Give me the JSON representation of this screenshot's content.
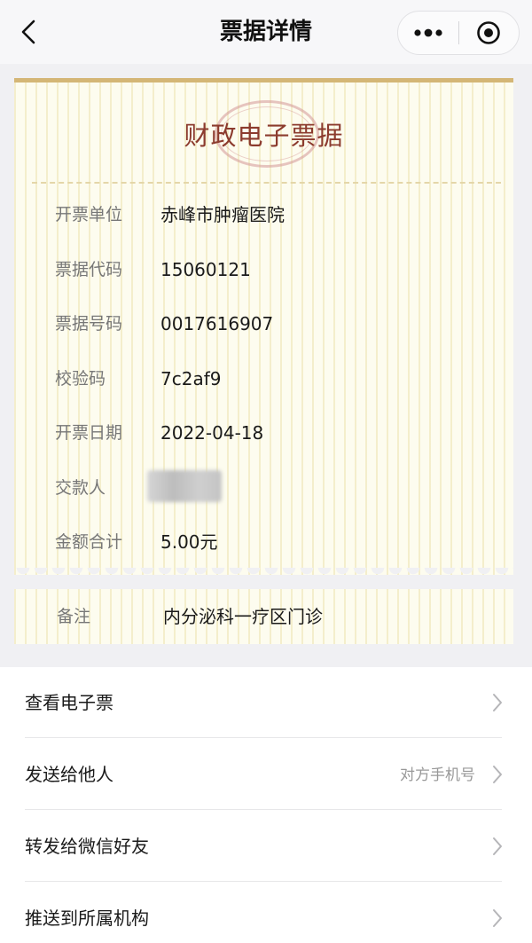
{
  "nav": {
    "title": "票据详情"
  },
  "receipt": {
    "title": "财政电子票据",
    "rows": [
      {
        "label": "开票单位",
        "value": "赤峰市肿瘤医院"
      },
      {
        "label": "票据代码",
        "value": "15060121"
      },
      {
        "label": "票据号码",
        "value": "0017616907"
      },
      {
        "label": "校验码",
        "value": "7c2af9"
      },
      {
        "label": "开票日期",
        "value": "2022-04-18"
      },
      {
        "label": "交款人",
        "value": ""
      },
      {
        "label": "金额合计",
        "value": "5.00元"
      }
    ],
    "remark": {
      "label": "备注",
      "value": "内分泌科一疗区门诊"
    }
  },
  "actions": [
    {
      "label": "查看电子票",
      "hint": ""
    },
    {
      "label": "发送给他人",
      "hint": "对方手机号"
    },
    {
      "label": "转发给微信好友",
      "hint": ""
    },
    {
      "label": "推送到所属机构",
      "hint": ""
    }
  ],
  "icons": {
    "back": "chevron-left-icon",
    "more": "more-dots-icon",
    "close": "target-circle-icon",
    "row_arrow": "chevron-right-icon"
  },
  "colors": {
    "accent_gold": "#d4b676",
    "title_red": "#8c3b2e",
    "paper": "#fdfcef"
  }
}
